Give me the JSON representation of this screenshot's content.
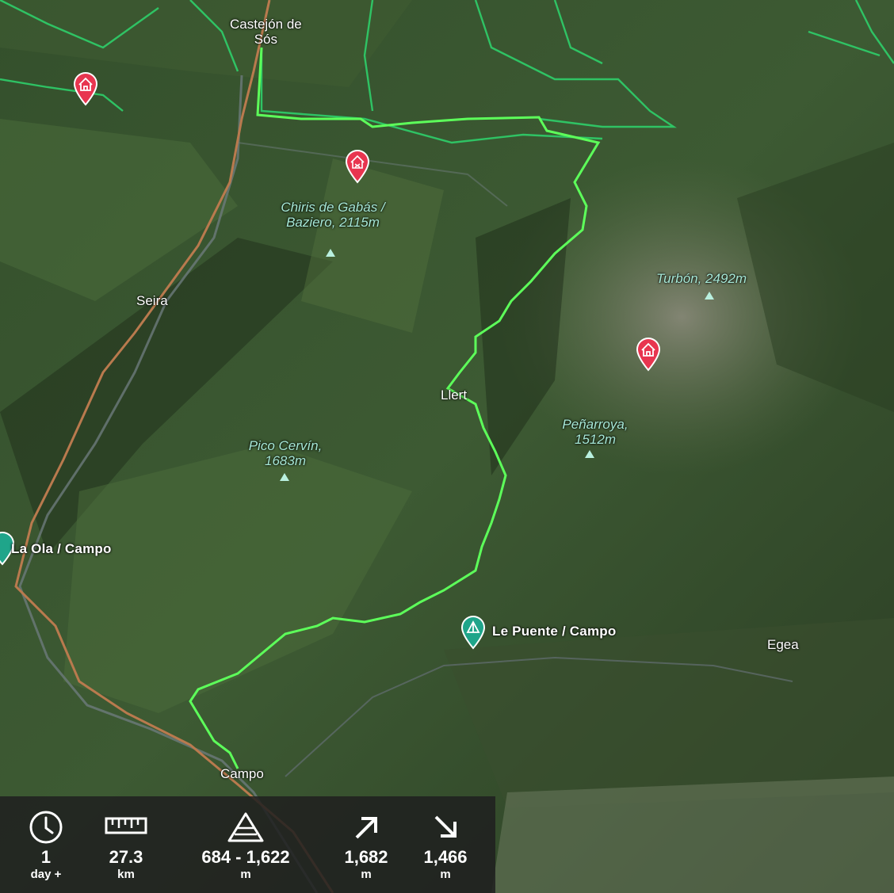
{
  "map": {
    "places": [
      {
        "name": "Castejón de\nSós",
        "kind": "town"
      },
      {
        "name": "Seira",
        "kind": "town"
      },
      {
        "name": "Llert",
        "kind": "town"
      },
      {
        "name": "Campo",
        "kind": "town"
      },
      {
        "name": "Egea",
        "kind": "town"
      }
    ],
    "peaks": [
      {
        "label": "Chiris de Gabás / Baziero, 2115m"
      },
      {
        "label": "Turbón, 2492m"
      },
      {
        "label": "Peñarroya, 1512m"
      },
      {
        "label": "Pico Cervín, 1683m"
      }
    ],
    "pois": [
      {
        "label": "La Ola / Campo",
        "icon": "campsite-icon"
      },
      {
        "label": "Le Puente / Campo",
        "icon": "campsite-icon"
      }
    ],
    "colors": {
      "route": "#5dff5a",
      "trails": "#2ecf6a",
      "road": "#b97a4e",
      "hut_pin": "#e8354f",
      "poi_pin": "#1fa58a"
    }
  },
  "stats": {
    "duration": {
      "value": "1",
      "unit": "day +",
      "icon": "clock-icon"
    },
    "distance": {
      "value": "27.3",
      "unit": "km",
      "icon": "ruler-icon"
    },
    "elevation_range": {
      "value": "684 - 1,622",
      "unit": "m",
      "icon": "mountain-icon"
    },
    "ascent": {
      "value": "1,682",
      "unit": "m",
      "icon": "arrow-up-right-icon"
    },
    "descent": {
      "value": "1,466",
      "unit": "m",
      "icon": "arrow-down-right-icon"
    }
  }
}
